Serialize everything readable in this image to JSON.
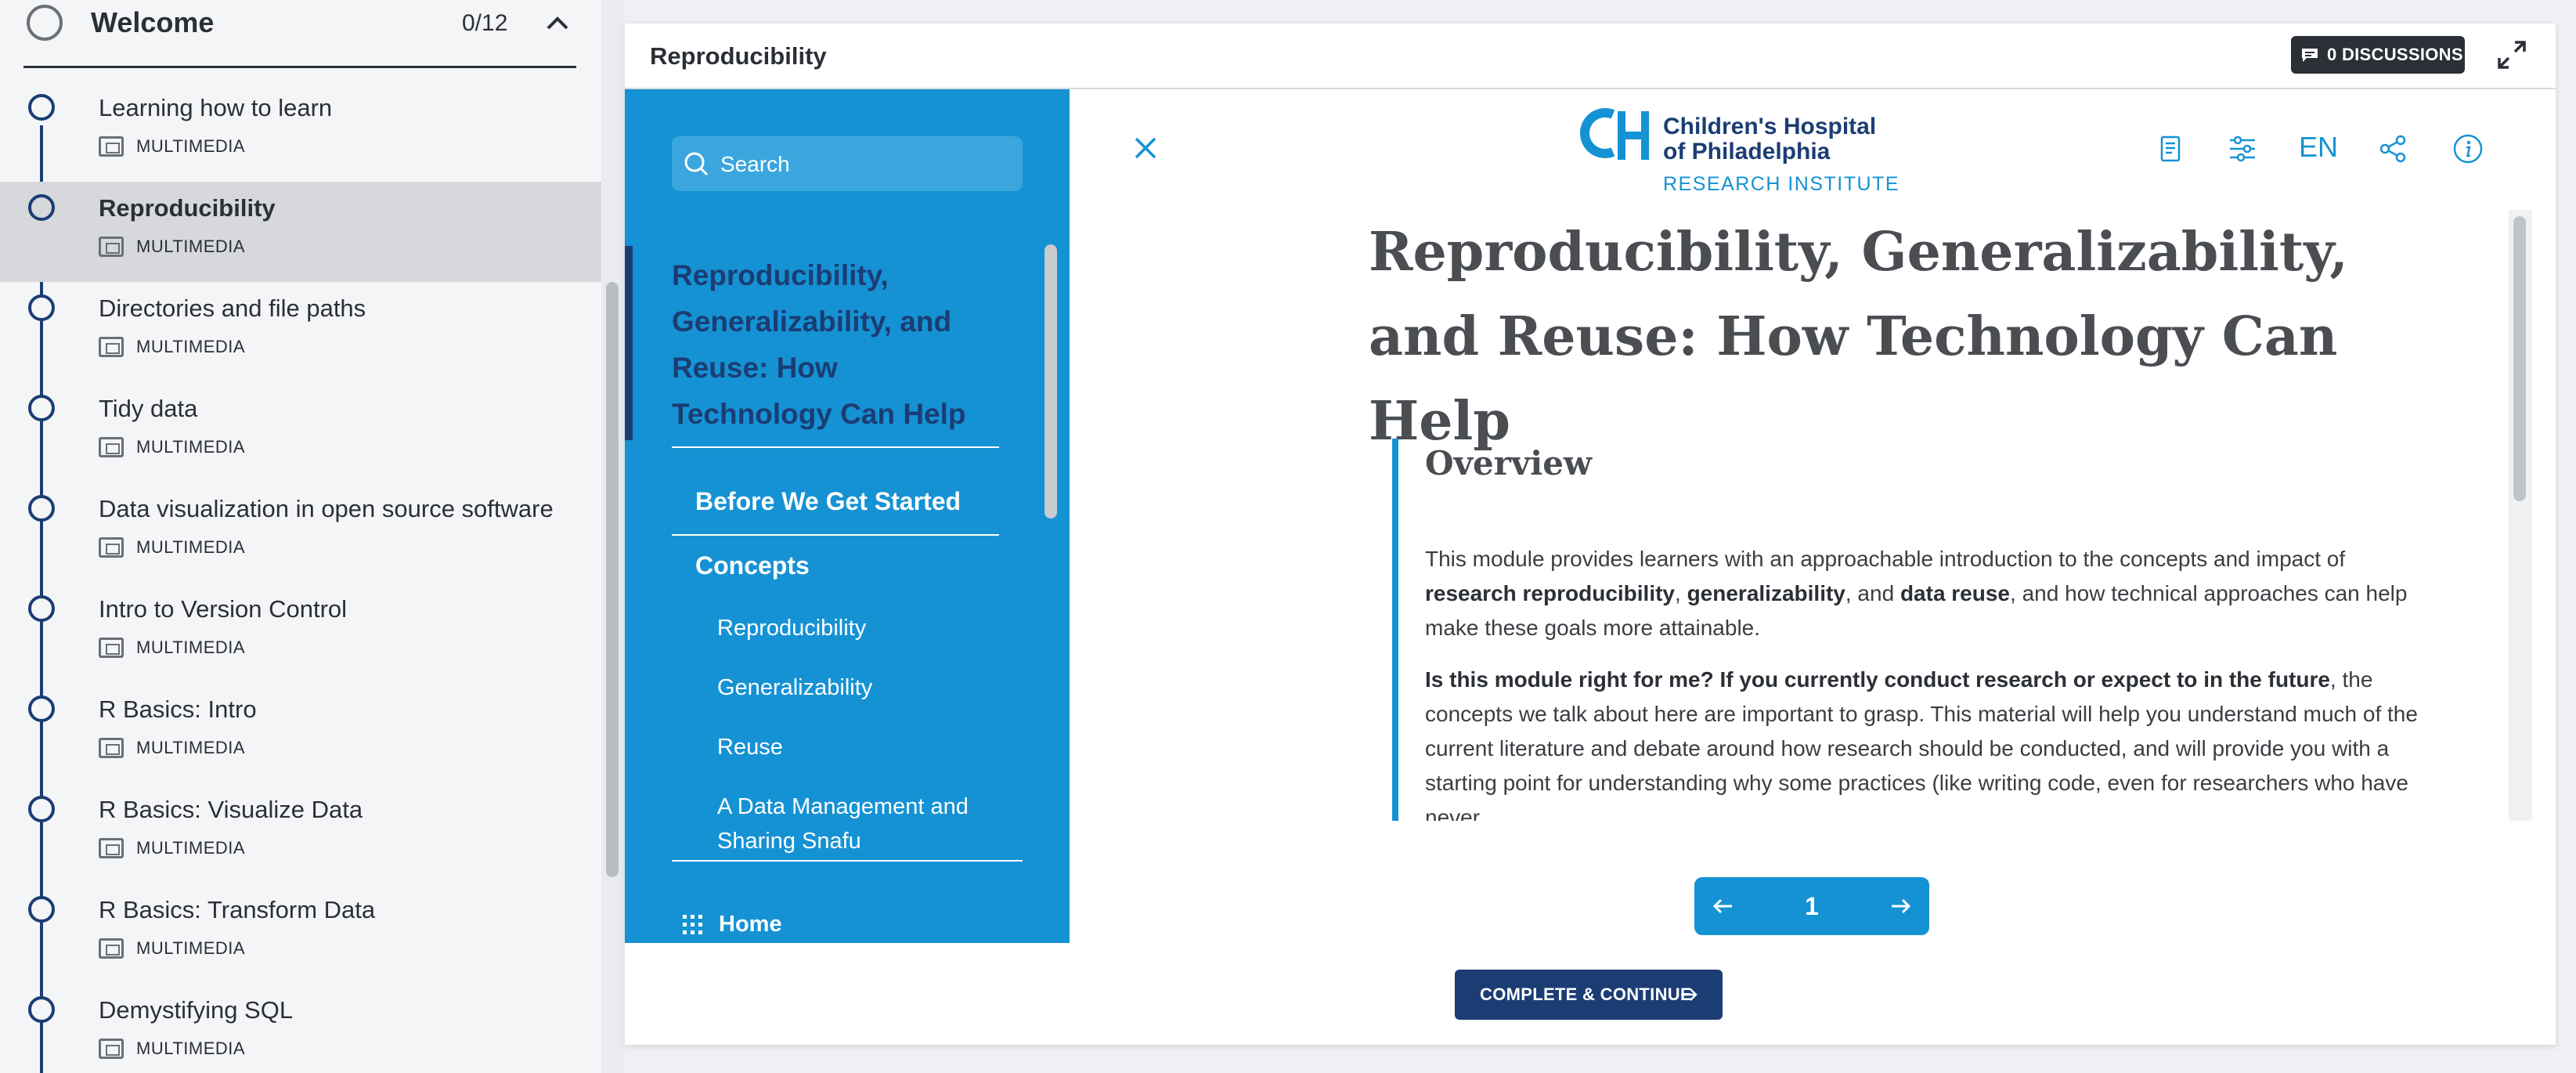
{
  "outline": {
    "section": {
      "title": "Welcome",
      "progress": "0/12",
      "expanded": true
    },
    "lessons": [
      {
        "title": "Learning how to learn",
        "type": "MULTIMEDIA",
        "active": false
      },
      {
        "title": "Reproducibility",
        "type": "MULTIMEDIA",
        "active": true
      },
      {
        "title": "Directories and file paths",
        "type": "MULTIMEDIA",
        "active": false
      },
      {
        "title": "Tidy data",
        "type": "MULTIMEDIA",
        "active": false
      },
      {
        "title": "Data visualization in open source software",
        "type": "MULTIMEDIA",
        "active": false
      },
      {
        "title": "Intro to Version Control",
        "type": "MULTIMEDIA",
        "active": false
      },
      {
        "title": "R Basics: Intro",
        "type": "MULTIMEDIA",
        "active": false
      },
      {
        "title": "R Basics: Visualize Data",
        "type": "MULTIMEDIA",
        "active": false
      },
      {
        "title": "R Basics: Transform Data",
        "type": "MULTIMEDIA",
        "active": false
      },
      {
        "title": "Demystifying SQL",
        "type": "MULTIMEDIA",
        "active": false
      }
    ]
  },
  "player": {
    "title": "Reproducibility",
    "discussions_label": "0 DISCUSSIONS",
    "complete_label": "COMPLETE & CONTINUE"
  },
  "module": {
    "search_placeholder": "Search",
    "toc": {
      "current": "Reproducibility, Generalizability, and Reuse: How Technology Can Help",
      "items": [
        {
          "label": "Before We Get Started",
          "level": 1
        },
        {
          "label": "Concepts",
          "level": 1
        },
        {
          "label": "Reproducibility",
          "level": 2
        },
        {
          "label": "Generalizability",
          "level": 2
        },
        {
          "label": "Reuse",
          "level": 2
        },
        {
          "label": "A Data Management and Sharing Snafu",
          "level": 2
        }
      ],
      "home_label": "Home"
    },
    "logo": {
      "line1": "Children's Hospital",
      "line2": "of Philadelphia",
      "line3": "RESEARCH INSTITUTE"
    },
    "language": "EN",
    "doc_title": "Reproducibility, Generalizability, and Reuse: How Technology Can Help",
    "overview_title": "Overview",
    "para1": {
      "t1": "This module provides learners with an approachable introduction to the concepts and impact of ",
      "b1": "research reproducibility",
      "t2": ", ",
      "b2": "generalizability",
      "t3": ", and ",
      "b3": "data reuse",
      "t4": ", and how technical approaches can help make these goals more attainable."
    },
    "para2": {
      "b1": "Is this module right for me? If you currently conduct research or expect to in the future",
      "t1": ", the concepts we talk about here are important to grasp. This material will help you understand much of the current literature and debate around how research should be conducted, and will provide you with a starting point for understanding why some practices (like writing code, even for researchers who have never"
    },
    "page": "1"
  },
  "colors": {
    "brand_blue": "#1592d4",
    "navy": "#1b3d73",
    "active_row": "#d6d8dc"
  },
  "icons": {
    "section": "circle-icon",
    "collapse": "chevron-up-icon",
    "lesson_type": "multimedia-icon",
    "search": "search-icon",
    "close": "close-icon",
    "toolbar": [
      "book-icon",
      "settings-sliders-icon",
      "share-icon",
      "info-icon"
    ],
    "home": "grid-icon",
    "discussions": "chat-icon",
    "expand": "expand-icon"
  }
}
